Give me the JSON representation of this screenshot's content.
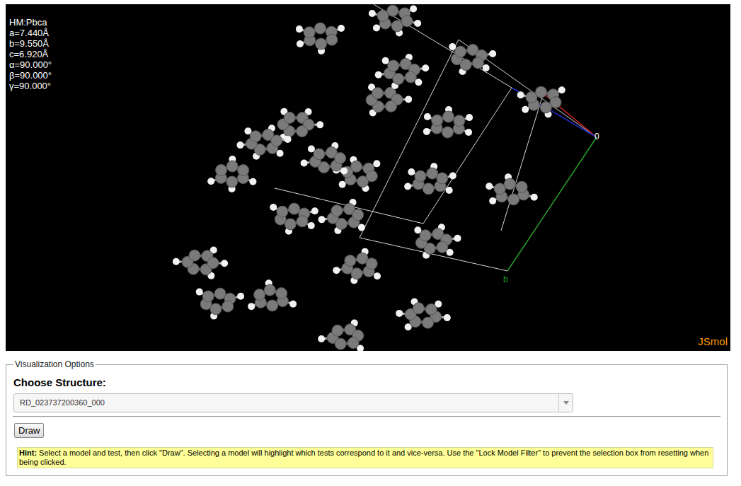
{
  "viewer": {
    "overlay": [
      "HM:Pbca",
      "a=7.440Å",
      "b=9.550Å",
      "c=6.920Å",
      "α=90.000°",
      "β=90.000°",
      "γ=90.000°"
    ],
    "axis_labels": [
      {
        "text": "0",
        "color": "#ffffff"
      },
      {
        "text": "b",
        "color": "#1f9a1f"
      }
    ],
    "brand": "JSmol"
  },
  "panel": {
    "legend": "Visualization Options",
    "label": "Choose Structure:",
    "select": {
      "value": "RD_023737200360_000"
    },
    "buttons": [
      "Draw"
    ],
    "hint": {
      "label": "Hint:",
      "text": "Select a model and test, then click \"Draw\". Selecting a model will highlight which tests correspond to it and vice-versa. Use the \"Lock Model Filter\" to prevent the selection box from resetting when being clicked."
    }
  }
}
